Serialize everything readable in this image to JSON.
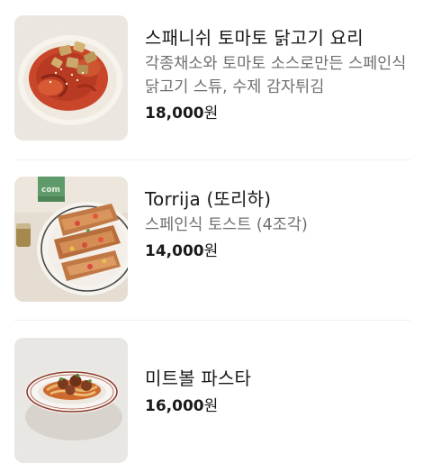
{
  "menu": {
    "items": [
      {
        "name": "스패니쉬 토마토 닭고기 요리",
        "description": "각종채소와 토마토 소스로만든 스페인식 닭고기 스튜, 수제 감자튀김",
        "price": "18,000",
        "currency": "원",
        "image": "chicken-tomato-stew-photo"
      },
      {
        "name": "Torrija (또리하)",
        "description": "스페인식 토스트 (4조각)",
        "price": "14,000",
        "currency": "원",
        "image": "torrija-toast-photo"
      },
      {
        "name": "미트볼 파스타",
        "description": "",
        "price": "16,000",
        "currency": "원",
        "image": "meatball-pasta-photo"
      }
    ]
  },
  "colors": {
    "text": "#1a1a1a",
    "description": "#6f6f6f",
    "divider": "#efefef"
  }
}
